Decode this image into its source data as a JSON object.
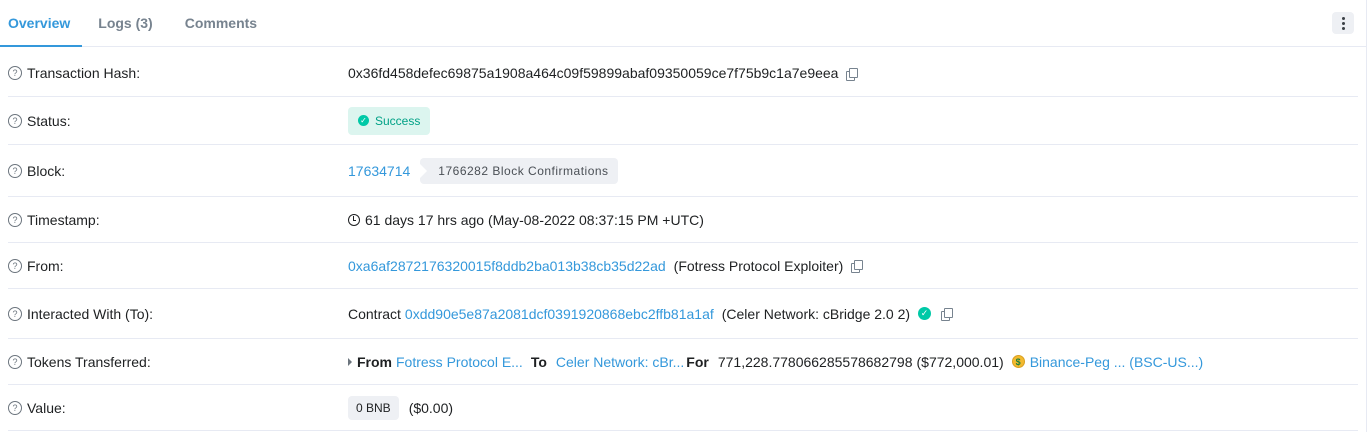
{
  "tabs": [
    {
      "label": "Overview",
      "active": true
    },
    {
      "label": "Logs (3)",
      "active": false
    },
    {
      "label": "Comments",
      "active": false
    }
  ],
  "rows": {
    "tx_hash": {
      "label": "Transaction Hash:",
      "value": "0x36fd458defec69875a1908a464c09f59899abaf09350059ce7f75b9c1a7e9eea"
    },
    "status": {
      "label": "Status:",
      "value": "Success"
    },
    "block": {
      "label": "Block:",
      "value": "17634714",
      "confirmations": "1766282 Block Confirmations"
    },
    "timestamp": {
      "label": "Timestamp:",
      "value": "61 days 17 hrs ago (May-08-2022 08:37:15 PM +UTC)"
    },
    "from": {
      "label": "From:",
      "address": "0xa6af2872176320015f8ddb2ba013b38cb35d22ad",
      "name": "(Fotress Protocol Exploiter)"
    },
    "interacted": {
      "label": "Interacted With (To):",
      "prefix": "Contract",
      "address": "0xdd90e5e87a2081dcf0391920868ebc2ffb81a1af",
      "name": "(Celer Network: cBridge 2.0 2)"
    },
    "tokens": {
      "label": "Tokens Transferred:",
      "from_label": "From",
      "from_value": "Fotress Protocol E...",
      "to_label": "To",
      "to_value": "Celer Network: cBr...",
      "for_label": "For",
      "amount": "771,228.778066285578682798",
      "usd": "($772,000.01)",
      "token": "Binance-Peg ... (BSC-US...)"
    },
    "value": {
      "label": "Value:",
      "amount": "0 BNB",
      "usd": "($0.00)"
    }
  },
  "colors": {
    "link": "#3498db",
    "success": "#00a186",
    "border": "#e7eaf3"
  },
  "icons": [
    "question-icon",
    "copy-icon",
    "check-circle-icon",
    "clock-icon",
    "verified-icon",
    "caret-right-icon",
    "token-coin-icon",
    "kebab-menu-icon"
  ]
}
